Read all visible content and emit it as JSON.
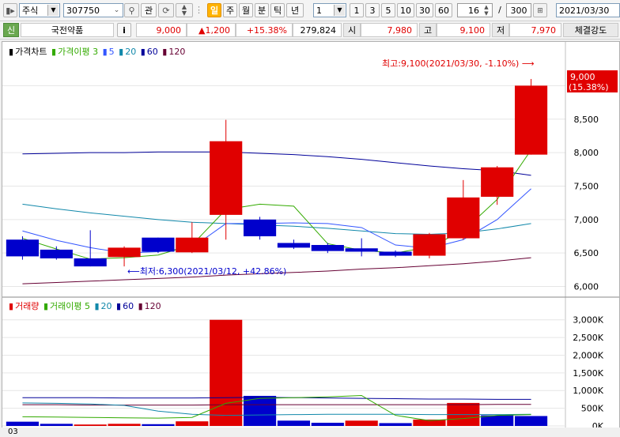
{
  "toolbar": {
    "market_type": "주식",
    "code": "307750",
    "btn_gwan": "관",
    "period_tabs": [
      "일",
      "주",
      "월",
      "분",
      "틱",
      "년"
    ],
    "active_period": "일",
    "interval_value": "1",
    "quick_intervals": [
      "1",
      "3",
      "5",
      "10",
      "30",
      "60"
    ],
    "count": "16",
    "separator": "/",
    "total": "300",
    "date": "2021/03/30"
  },
  "info": {
    "badge": "신",
    "name": "국전약품",
    "info_btn": "i",
    "price": "9,000",
    "change": "▲1,200",
    "change_rate": "+15.38%",
    "volume": "279,824",
    "open_label": "시",
    "open": "7,980",
    "high_label": "고",
    "high": "9,100",
    "low_label": "저",
    "low": "7,970",
    "strength_label": "체결강도"
  },
  "price_legend": {
    "title": "가격차트",
    "ma_label": "가격이평 3",
    "ma5": "5",
    "ma20": "20",
    "ma60": "60",
    "ma120": "120"
  },
  "volume_legend": {
    "title": "거래량",
    "ma_label": "거래이평 5",
    "ma20": "20",
    "ma60": "60",
    "ma120": "120"
  },
  "annotations": {
    "high_note": "최고:9,100(2021/03/30, -1.10%)",
    "low_note": "최저:6,300(2021/03/12, +42.86%)",
    "last_price": "9,000",
    "last_rate": "(15.38%)"
  },
  "bottom": {
    "date_label": "03"
  },
  "colors": {
    "up": "#e00000",
    "down": "#0000cc",
    "ma3": "#33aa00",
    "ma5": "#3355ff",
    "ma20": "#1188aa",
    "ma60": "#000099",
    "ma120": "#660033"
  },
  "chart_data": [
    {
      "type": "candlestick",
      "title": "가격차트",
      "ylim": [
        5900,
        9300
      ],
      "y_ticks": [
        "9,000",
        "8,500",
        "8,000",
        "7,500",
        "7,000",
        "6,500",
        "6,000"
      ],
      "y_tick_values": [
        9000,
        8500,
        8000,
        7500,
        7000,
        6500,
        6000
      ],
      "candles": [
        {
          "open": 6700,
          "close": 6450,
          "high": 6750,
          "low": 6400
        },
        {
          "open": 6550,
          "close": 6420,
          "high": 6600,
          "low": 6400
        },
        {
          "open": 6420,
          "close": 6300,
          "high": 6840,
          "low": 6300
        },
        {
          "open": 6440,
          "close": 6580,
          "high": 6600,
          "low": 6300
        },
        {
          "open": 6730,
          "close": 6520,
          "high": 6730,
          "low": 6500
        },
        {
          "open": 6510,
          "close": 6730,
          "high": 6960,
          "low": 6500
        },
        {
          "open": 7070,
          "close": 8170,
          "high": 8490,
          "low": 6700
        },
        {
          "open": 7000,
          "close": 6750,
          "high": 7040,
          "low": 6700
        },
        {
          "open": 6650,
          "close": 6580,
          "high": 6700,
          "low": 6560
        },
        {
          "open": 6620,
          "close": 6530,
          "high": 6650,
          "low": 6500
        },
        {
          "open": 6570,
          "close": 6520,
          "high": 6720,
          "low": 6450
        },
        {
          "open": 6520,
          "close": 6460,
          "high": 6540,
          "low": 6440
        },
        {
          "open": 6460,
          "close": 6780,
          "high": 6800,
          "low": 6420
        },
        {
          "open": 6720,
          "close": 7330,
          "high": 7590,
          "low": 6700
        },
        {
          "open": 7340,
          "close": 7780,
          "high": 7800,
          "low": 7220
        },
        {
          "open": 7970,
          "close": 9000,
          "high": 9100,
          "low": 7970
        }
      ],
      "ma3": [
        6720,
        6560,
        6410,
        6430,
        6470,
        6620,
        7150,
        7230,
        7200,
        6640,
        6540,
        6500,
        6590,
        6830,
        7300,
        8040
      ],
      "ma5": [
        6830,
        6690,
        6580,
        6500,
        6520,
        6580,
        6940,
        6940,
        6950,
        6940,
        6880,
        6620,
        6570,
        6700,
        7000,
        7460
      ],
      "ma20": [
        7230,
        7160,
        7100,
        7050,
        7000,
        6960,
        6940,
        6920,
        6900,
        6870,
        6830,
        6790,
        6780,
        6800,
        6860,
        6940
      ],
      "ma60": [
        7980,
        7990,
        8000,
        8000,
        8010,
        8010,
        8010,
        7990,
        7970,
        7940,
        7900,
        7850,
        7800,
        7760,
        7730,
        7660
      ],
      "ma120": [
        6040,
        6060,
        6080,
        6100,
        6120,
        6140,
        6170,
        6190,
        6210,
        6230,
        6260,
        6280,
        6310,
        6340,
        6380,
        6430
      ]
    },
    {
      "type": "bar",
      "title": "거래량",
      "ylim": [
        0,
        3150
      ],
      "y_ticks": [
        "3,000K",
        "2,500K",
        "2,000K",
        "1,500K",
        "1,000K",
        "500K",
        "0K"
      ],
      "y_tick_values": [
        3000,
        2500,
        2000,
        1500,
        1000,
        500,
        0
      ],
      "values": [
        120,
        60,
        40,
        60,
        50,
        130,
        3000,
        850,
        150,
        90,
        150,
        80,
        180,
        650,
        300,
        280
      ],
      "up": [
        false,
        false,
        true,
        true,
        false,
        true,
        true,
        false,
        false,
        false,
        true,
        false,
        true,
        true,
        false,
        false
      ],
      "ma5": [
        260,
        250,
        240,
        230,
        220,
        240,
        640,
        780,
        800,
        820,
        860,
        300,
        150,
        210,
        300,
        320
      ],
      "ma20": [
        650,
        640,
        620,
        580,
        420,
        330,
        300,
        310,
        320,
        330,
        330,
        330,
        320,
        320,
        320,
        330
      ],
      "ma60": [
        800,
        800,
        800,
        790,
        790,
        790,
        800,
        810,
        800,
        790,
        780,
        770,
        760,
        760,
        750,
        750
      ],
      "ma120": [
        600,
        600,
        590,
        590,
        590,
        590,
        600,
        600,
        600,
        600,
        600,
        600,
        600,
        600,
        610,
        610
      ]
    }
  ]
}
